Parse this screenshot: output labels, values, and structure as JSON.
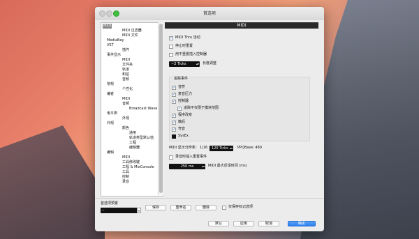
{
  "window": {
    "title": "首选项"
  },
  "tree": {
    "items": [
      {
        "label": "MIDI",
        "selected": true
      },
      {
        "label": "MIDI 过滤器"
      },
      {
        "label": "MIDI 文件"
      },
      {
        "label": "MediaBay"
      },
      {
        "label": "VST"
      },
      {
        "label": "插件"
      },
      {
        "label": "事件显示"
      },
      {
        "label": "MIDI"
      },
      {
        "label": "文件夹"
      },
      {
        "label": "轨道"
      },
      {
        "label": "和弦"
      },
      {
        "label": "音频"
      },
      {
        "label": "常规"
      },
      {
        "label": "个性化"
      },
      {
        "label": "编者"
      },
      {
        "label": "MIDI"
      },
      {
        "label": "音频"
      },
      {
        "label": "Broadcast Wave"
      },
      {
        "label": "电平表"
      },
      {
        "label": "外观"
      },
      {
        "label": "外观"
      },
      {
        "label": "颜色"
      },
      {
        "label": "通用"
      },
      {
        "label": "轨道类型默认值"
      },
      {
        "label": "工程"
      },
      {
        "label": "编辑器"
      },
      {
        "label": "编辑"
      },
      {
        "label": "MIDI"
      },
      {
        "label": "工具修改键"
      },
      {
        "label": "工程 & MixConsole"
      },
      {
        "label": "工具"
      },
      {
        "label": "控制"
      },
      {
        "label": "录音"
      }
    ]
  },
  "panel": {
    "title": "MIDI",
    "options": [
      {
        "label": "MIDI Thru 活动",
        "checked": true
      },
      {
        "label": "停止时重置",
        "checked": false
      },
      {
        "label": "用不重置插入控制器",
        "checked": false
      }
    ],
    "length_value": "~2 Ticks",
    "length_label": "长度调整",
    "chase_group": {
      "title": "追踪事件",
      "items": [
        {
          "label": "音符",
          "checked": true
        },
        {
          "label": "复音压力",
          "checked": true
        },
        {
          "label": "控制器",
          "checked": true
        },
        {
          "label": "追踪不仅限于模块范围",
          "checked": true
        },
        {
          "label": "程序改变",
          "checked": true
        },
        {
          "label": "触后",
          "checked": true
        },
        {
          "label": "弯音",
          "checked": true
        },
        {
          "label": "SysEx",
          "checked": true
        }
      ]
    },
    "resolution_label": "MIDI 显示分辨率：",
    "resolution_value": "1/16",
    "ticks_value": "120 Ticks",
    "ppq_label": "PPQBase: 480",
    "insert_reset": "录音时插入重置事件",
    "max_feedback_value": "250 ms",
    "max_feedback_label": "MIDI 最大反馈时间 (ms)"
  },
  "footer": {
    "preset_label": "首选项预置",
    "preset_value": "--",
    "save": "保存",
    "rename": "重命名",
    "delete": "删除",
    "store_marked": "仅保存标记选项",
    "defaults": "默认",
    "apply": "应用",
    "cancel": "取消",
    "ok": "确定"
  }
}
